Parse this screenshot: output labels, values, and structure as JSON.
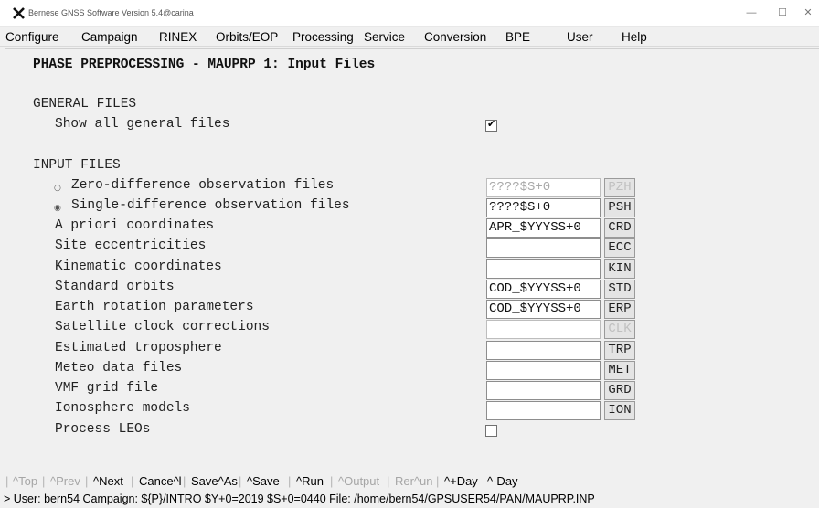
{
  "window": {
    "title": "Bernese GNSS Software Version 5.4@carina",
    "controls": {
      "minimize": "—",
      "maximize": "☐",
      "close": "✕"
    }
  },
  "menu": [
    "Configure",
    "Campaign",
    "RINEX",
    "Orbits/EOP",
    "Processing",
    "Service",
    "Conversion",
    "BPE",
    "User",
    "Help"
  ],
  "panel": {
    "title": "PHASE PREPROCESSING - MAUPRP 1: Input Files",
    "general_heading": "GENERAL FILES",
    "show_all_label": "Show all general files",
    "show_all_checked": true,
    "input_heading": "INPUT FILES",
    "rows": [
      {
        "label": "Zero-difference observation files",
        "value": "????$S+0",
        "ext": "PZH",
        "disabled": true,
        "radio": "○"
      },
      {
        "label": "Single-difference observation files",
        "value": "????$S+0",
        "ext": "PSH",
        "disabled": false,
        "radio": "◉"
      },
      {
        "label": "A priori coordinates",
        "value": "APR_$YYYSS+0",
        "ext": "CRD",
        "disabled": false
      },
      {
        "label": "Site eccentricities",
        "value": "",
        "ext": "ECC",
        "disabled": false
      },
      {
        "label": "Kinematic coordinates",
        "value": "",
        "ext": "KIN",
        "disabled": false
      },
      {
        "label": "Standard orbits",
        "value": "COD_$YYYSS+0",
        "ext": "STD",
        "disabled": false
      },
      {
        "label": "Earth rotation parameters",
        "value": "COD_$YYYSS+0",
        "ext": "ERP",
        "disabled": false
      },
      {
        "label": "Satellite clock corrections",
        "value": "",
        "ext": "CLK",
        "disabled": true
      },
      {
        "label": "Estimated troposphere",
        "value": "",
        "ext": "TRP",
        "disabled": false
      },
      {
        "label": "Meteo data files",
        "value": "",
        "ext": "MET",
        "disabled": false
      },
      {
        "label": "VMF grid file",
        "value": "",
        "ext": "GRD",
        "disabled": false
      },
      {
        "label": "Ionosphere models",
        "value": "",
        "ext": "ION",
        "disabled": false
      }
    ],
    "process_leos_label": "Process LEOs",
    "process_leos_checked": false
  },
  "buttons": [
    {
      "label": "^Top",
      "enabled": false
    },
    {
      "label": "^Prev",
      "enabled": false
    },
    {
      "label": "^Next",
      "enabled": true
    },
    {
      "label": "Cance^l",
      "enabled": true
    },
    {
      "label": "Save^As",
      "enabled": true
    },
    {
      "label": "^Save",
      "enabled": true
    },
    {
      "label": "^Run",
      "enabled": true
    },
    {
      "label": "^Output",
      "enabled": false
    },
    {
      "label": "Rer^un",
      "enabled": false
    },
    {
      "label": "^+Day",
      "enabled": true
    },
    {
      "label": "^-Day",
      "enabled": true
    }
  ],
  "status": "> User: bern54  Campaign: ${P}/INTRO  $Y+0=2019  $S+0=0440  File: /home/bern54/GPSUSER54/PAN/MAUPRP.INP"
}
